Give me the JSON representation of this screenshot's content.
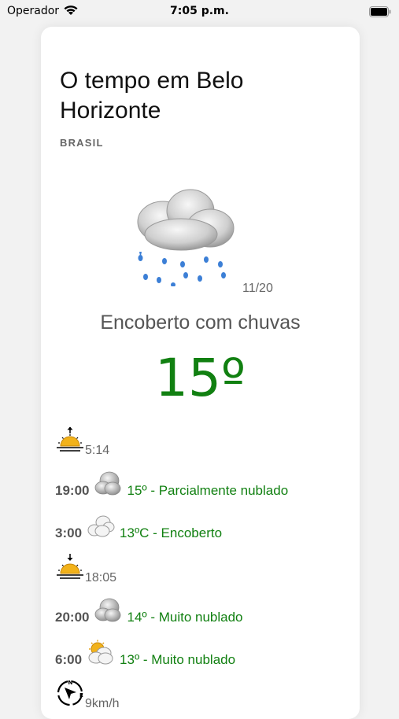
{
  "status": {
    "carrier": "Operador",
    "time": "7:05 p.m."
  },
  "weather": {
    "title": "O tempo em Belo Horizonte",
    "country": "BRASIL",
    "date": "11/20",
    "condition": "Encoberto com chuvas",
    "temperature": "15º",
    "icon": "cloud-rain-icon"
  },
  "details": {
    "sunrise": "5:14",
    "sunset": "18:05",
    "wind": "9km/h"
  },
  "forecast": [
    {
      "hour": "19:00",
      "text": "15º - Parcialmente nublado",
      "icon": "cloud-icon"
    },
    {
      "hour": "3:00",
      "text": "13ºC - Encoberto",
      "icon": "clouds-icon"
    },
    {
      "hour": "20:00",
      "text": "14º - Muito nublado",
      "icon": "cloud-icon"
    },
    {
      "hour": "6:00",
      "text": "13º - Muito nublado",
      "icon": "sun-cloud-icon"
    }
  ],
  "colors": {
    "temperature": "#118011",
    "forecast_text": "#118011"
  }
}
